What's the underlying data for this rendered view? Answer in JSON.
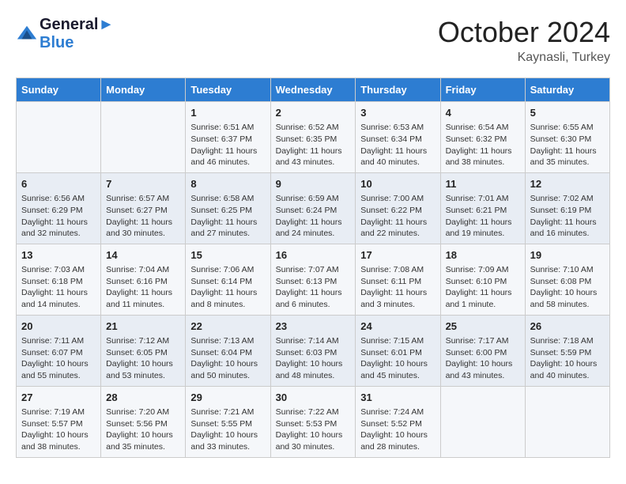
{
  "header": {
    "logo_line1": "General",
    "logo_line2": "Blue",
    "month": "October 2024",
    "location": "Kaynasli, Turkey"
  },
  "columns": [
    "Sunday",
    "Monday",
    "Tuesday",
    "Wednesday",
    "Thursday",
    "Friday",
    "Saturday"
  ],
  "weeks": [
    [
      {
        "day": "",
        "sunrise": "",
        "sunset": "",
        "daylight": ""
      },
      {
        "day": "",
        "sunrise": "",
        "sunset": "",
        "daylight": ""
      },
      {
        "day": "1",
        "sunrise": "Sunrise: 6:51 AM",
        "sunset": "Sunset: 6:37 PM",
        "daylight": "Daylight: 11 hours and 46 minutes."
      },
      {
        "day": "2",
        "sunrise": "Sunrise: 6:52 AM",
        "sunset": "Sunset: 6:35 PM",
        "daylight": "Daylight: 11 hours and 43 minutes."
      },
      {
        "day": "3",
        "sunrise": "Sunrise: 6:53 AM",
        "sunset": "Sunset: 6:34 PM",
        "daylight": "Daylight: 11 hours and 40 minutes."
      },
      {
        "day": "4",
        "sunrise": "Sunrise: 6:54 AM",
        "sunset": "Sunset: 6:32 PM",
        "daylight": "Daylight: 11 hours and 38 minutes."
      },
      {
        "day": "5",
        "sunrise": "Sunrise: 6:55 AM",
        "sunset": "Sunset: 6:30 PM",
        "daylight": "Daylight: 11 hours and 35 minutes."
      }
    ],
    [
      {
        "day": "6",
        "sunrise": "Sunrise: 6:56 AM",
        "sunset": "Sunset: 6:29 PM",
        "daylight": "Daylight: 11 hours and 32 minutes."
      },
      {
        "day": "7",
        "sunrise": "Sunrise: 6:57 AM",
        "sunset": "Sunset: 6:27 PM",
        "daylight": "Daylight: 11 hours and 30 minutes."
      },
      {
        "day": "8",
        "sunrise": "Sunrise: 6:58 AM",
        "sunset": "Sunset: 6:25 PM",
        "daylight": "Daylight: 11 hours and 27 minutes."
      },
      {
        "day": "9",
        "sunrise": "Sunrise: 6:59 AM",
        "sunset": "Sunset: 6:24 PM",
        "daylight": "Daylight: 11 hours and 24 minutes."
      },
      {
        "day": "10",
        "sunrise": "Sunrise: 7:00 AM",
        "sunset": "Sunset: 6:22 PM",
        "daylight": "Daylight: 11 hours and 22 minutes."
      },
      {
        "day": "11",
        "sunrise": "Sunrise: 7:01 AM",
        "sunset": "Sunset: 6:21 PM",
        "daylight": "Daylight: 11 hours and 19 minutes."
      },
      {
        "day": "12",
        "sunrise": "Sunrise: 7:02 AM",
        "sunset": "Sunset: 6:19 PM",
        "daylight": "Daylight: 11 hours and 16 minutes."
      }
    ],
    [
      {
        "day": "13",
        "sunrise": "Sunrise: 7:03 AM",
        "sunset": "Sunset: 6:18 PM",
        "daylight": "Daylight: 11 hours and 14 minutes."
      },
      {
        "day": "14",
        "sunrise": "Sunrise: 7:04 AM",
        "sunset": "Sunset: 6:16 PM",
        "daylight": "Daylight: 11 hours and 11 minutes."
      },
      {
        "day": "15",
        "sunrise": "Sunrise: 7:06 AM",
        "sunset": "Sunset: 6:14 PM",
        "daylight": "Daylight: 11 hours and 8 minutes."
      },
      {
        "day": "16",
        "sunrise": "Sunrise: 7:07 AM",
        "sunset": "Sunset: 6:13 PM",
        "daylight": "Daylight: 11 hours and 6 minutes."
      },
      {
        "day": "17",
        "sunrise": "Sunrise: 7:08 AM",
        "sunset": "Sunset: 6:11 PM",
        "daylight": "Daylight: 11 hours and 3 minutes."
      },
      {
        "day": "18",
        "sunrise": "Sunrise: 7:09 AM",
        "sunset": "Sunset: 6:10 PM",
        "daylight": "Daylight: 11 hours and 1 minute."
      },
      {
        "day": "19",
        "sunrise": "Sunrise: 7:10 AM",
        "sunset": "Sunset: 6:08 PM",
        "daylight": "Daylight: 10 hours and 58 minutes."
      }
    ],
    [
      {
        "day": "20",
        "sunrise": "Sunrise: 7:11 AM",
        "sunset": "Sunset: 6:07 PM",
        "daylight": "Daylight: 10 hours and 55 minutes."
      },
      {
        "day": "21",
        "sunrise": "Sunrise: 7:12 AM",
        "sunset": "Sunset: 6:05 PM",
        "daylight": "Daylight: 10 hours and 53 minutes."
      },
      {
        "day": "22",
        "sunrise": "Sunrise: 7:13 AM",
        "sunset": "Sunset: 6:04 PM",
        "daylight": "Daylight: 10 hours and 50 minutes."
      },
      {
        "day": "23",
        "sunrise": "Sunrise: 7:14 AM",
        "sunset": "Sunset: 6:03 PM",
        "daylight": "Daylight: 10 hours and 48 minutes."
      },
      {
        "day": "24",
        "sunrise": "Sunrise: 7:15 AM",
        "sunset": "Sunset: 6:01 PM",
        "daylight": "Daylight: 10 hours and 45 minutes."
      },
      {
        "day": "25",
        "sunrise": "Sunrise: 7:17 AM",
        "sunset": "Sunset: 6:00 PM",
        "daylight": "Daylight: 10 hours and 43 minutes."
      },
      {
        "day": "26",
        "sunrise": "Sunrise: 7:18 AM",
        "sunset": "Sunset: 5:59 PM",
        "daylight": "Daylight: 10 hours and 40 minutes."
      }
    ],
    [
      {
        "day": "27",
        "sunrise": "Sunrise: 7:19 AM",
        "sunset": "Sunset: 5:57 PM",
        "daylight": "Daylight: 10 hours and 38 minutes."
      },
      {
        "day": "28",
        "sunrise": "Sunrise: 7:20 AM",
        "sunset": "Sunset: 5:56 PM",
        "daylight": "Daylight: 10 hours and 35 minutes."
      },
      {
        "day": "29",
        "sunrise": "Sunrise: 7:21 AM",
        "sunset": "Sunset: 5:55 PM",
        "daylight": "Daylight: 10 hours and 33 minutes."
      },
      {
        "day": "30",
        "sunrise": "Sunrise: 7:22 AM",
        "sunset": "Sunset: 5:53 PM",
        "daylight": "Daylight: 10 hours and 30 minutes."
      },
      {
        "day": "31",
        "sunrise": "Sunrise: 7:24 AM",
        "sunset": "Sunset: 5:52 PM",
        "daylight": "Daylight: 10 hours and 28 minutes."
      },
      {
        "day": "",
        "sunrise": "",
        "sunset": "",
        "daylight": ""
      },
      {
        "day": "",
        "sunrise": "",
        "sunset": "",
        "daylight": ""
      }
    ]
  ]
}
